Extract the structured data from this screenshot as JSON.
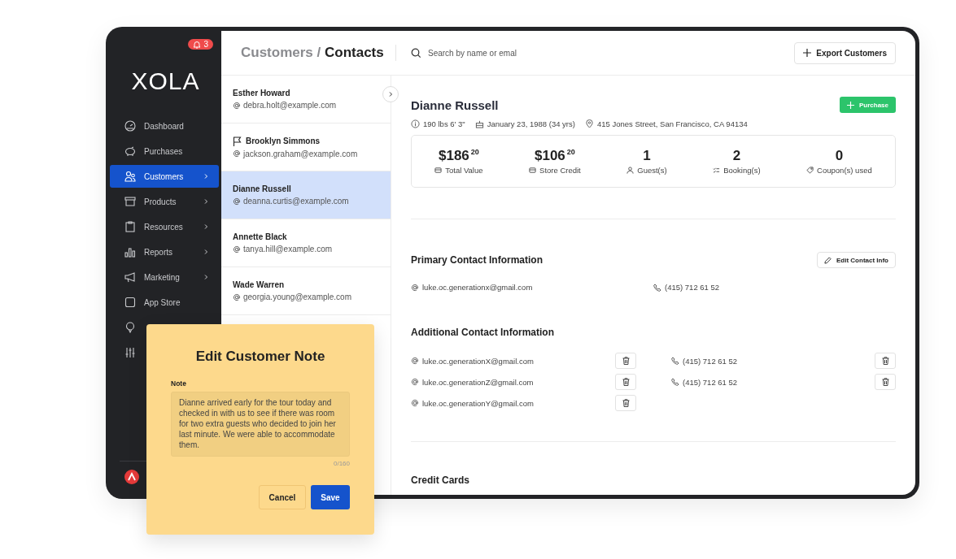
{
  "sidebar": {
    "notification_count": "3",
    "logo": "XOLA",
    "items": [
      {
        "label": "Dashboard",
        "selected": false,
        "expandable": false
      },
      {
        "label": "Purchases",
        "selected": false,
        "expandable": false
      },
      {
        "label": "Customers",
        "selected": true,
        "expandable": true
      },
      {
        "label": "Products",
        "selected": false,
        "expandable": true
      },
      {
        "label": "Resources",
        "selected": false,
        "expandable": true
      },
      {
        "label": "Reports",
        "selected": false,
        "expandable": true
      },
      {
        "label": "Marketing",
        "selected": false,
        "expandable": true
      },
      {
        "label": "App Store",
        "selected": false,
        "expandable": false
      },
      {
        "selected": false
      },
      {
        "selected": false
      }
    ]
  },
  "header": {
    "breadcrumb_parent": "Customers /",
    "breadcrumb_current": "Contacts",
    "search": {
      "placeholder": "Search by name or emal"
    },
    "export_button": "Export Customers"
  },
  "contacts": [
    {
      "name": "Esther Howard",
      "email": "debra.holt@example.com",
      "flagged": false,
      "selected": false
    },
    {
      "name": "Brooklyn Simmons",
      "email": "jackson.graham@example.com",
      "flagged": true,
      "selected": false
    },
    {
      "name": "Dianne Russell",
      "email": "deanna.curtis@example.com",
      "flagged": false,
      "selected": true
    },
    {
      "name": "Annette Black",
      "email": "tanya.hill@example.com",
      "flagged": false,
      "selected": false
    },
    {
      "name": "Wade Warren",
      "email": "georgia.young@example.com",
      "flagged": false,
      "selected": false
    }
  ],
  "customer": {
    "name": "Dianne Russell",
    "purchase_button": "Purchase",
    "meta": [
      {
        "kind": "info",
        "text": "190 lbs 6' 3\""
      },
      {
        "kind": "birthday",
        "text": "January 23, 1988 (34 yrs)"
      },
      {
        "kind": "location",
        "text": "415 Jones Street, San Francisco, CA 94134"
      }
    ],
    "stats": [
      {
        "kind": "money",
        "value": "$186$^{20}$",
        "label": "Total Value"
      },
      {
        "kind": "credit",
        "value": "$106$^{20}$",
        "label": "Store Credit"
      },
      {
        "kind": "guest",
        "value": "1",
        "label": "Guest(s)"
      },
      {
        "kind": "booking",
        "value": "2",
        "label": "Booking(s)"
      },
      {
        "kind": "coupon",
        "value": "0",
        "label": "Coupon(s) used"
      }
    ]
  },
  "primary_contact": {
    "title": "Primary Contact Information",
    "edit_button": "Edit Contact Info",
    "email": "luke.oc.generationx@gmail.com",
    "phone": "(415) 712 61 52"
  },
  "additional_contact": {
    "title": "Additional Contact Information",
    "emails": [
      "luke.oc.generationX@gmail.com",
      "luke.oc.generationZ@gmail.com",
      "luke.oc.generationY@gmail.com"
    ],
    "phones": [
      "(415) 712 61 52",
      "(415) 712 61 52"
    ]
  },
  "credit_cards": {
    "title": "Credit Cards"
  },
  "note_dialog": {
    "title": "Edit Customer Note",
    "label": "Note",
    "value": "Dianne arrived early for the tour today and checked in with us to see if there was room for two extra guests who decided to join her last minute. We were able to accommodate them.",
    "counter": "0/160",
    "cancel": "Cancel",
    "save": "Save"
  }
}
